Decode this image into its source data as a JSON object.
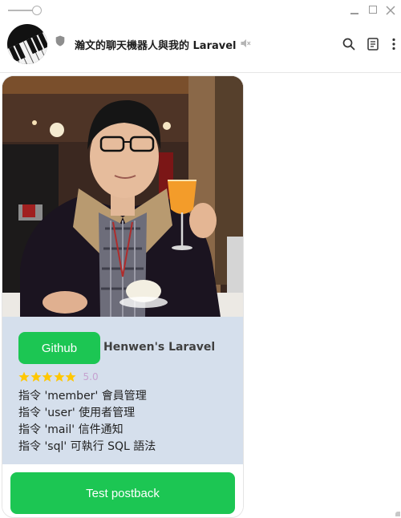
{
  "window": {
    "controls": [
      "minimize",
      "maximize",
      "close"
    ]
  },
  "header": {
    "title": "瀚文的聊天機器人與我的 Laravel",
    "icons": [
      "shield-icon",
      "mute-icon",
      "search-icon",
      "notes-icon",
      "more-icon"
    ]
  },
  "card": {
    "button_label": "Github",
    "repo_name": "Henwen's Laravel",
    "rating": {
      "stars": 5,
      "max": 5,
      "value": "5.0",
      "star_color": "#FFC700"
    },
    "commands": [
      "指令 'member' 會員管理",
      "指令 'user' 使用者管理",
      "指令 'mail' 信件通知",
      "指令 'sql' 可執行 SQL 語法"
    ],
    "footer_button_label": "Test postback"
  },
  "colors": {
    "accent": "#1CC653",
    "info_background": "#D5DFEC"
  }
}
